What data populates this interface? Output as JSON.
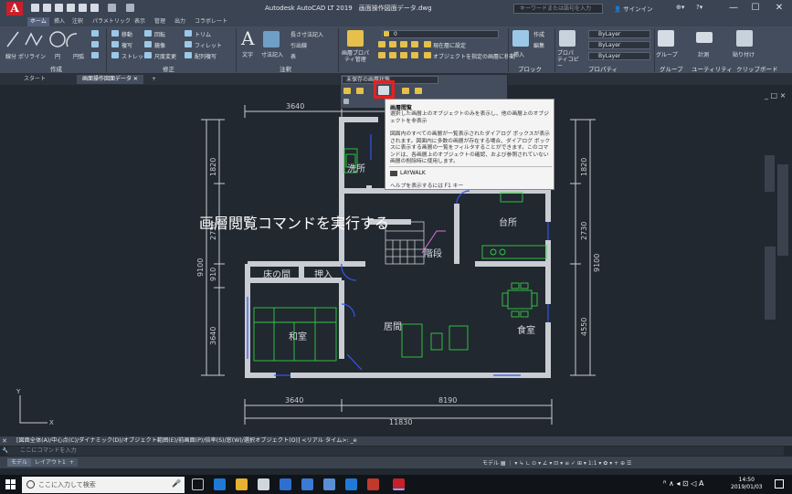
{
  "app": {
    "title": "Autodesk AutoCAD LT 2019　画面操作図面データ.dwg",
    "logo": "A",
    "search_placeholder": "キーワードまたは語句を入力",
    "signin": "サインイン",
    "colors": {
      "accent_red": "#e62020",
      "logo": "#c8202a",
      "canvas": "#212830",
      "plan_lines": "#c9ccd2"
    }
  },
  "ribbon_tabs": [
    "ホーム",
    "挿入",
    "注釈",
    "パラメトリック",
    "表示",
    "管理",
    "出力",
    "コラボレート"
  ],
  "ribbon": {
    "draw_tools": [
      "線分",
      "ポリライン",
      "円",
      "円弧"
    ],
    "modify_tools": [
      "移動",
      "回転",
      "トリム",
      "複写",
      "鏡像",
      "フィレット",
      "ストレッチ",
      "尺度変更",
      "配列複写"
    ],
    "annot_tools": [
      "文字",
      "寸法記入",
      "長さ寸法記入",
      "引出線",
      "表"
    ],
    "layer_tools": [
      "画層プロパティ管理",
      "現在層に設定",
      "オブジェクトを指定の画層に移動"
    ],
    "layer_current": "0",
    "block_tools": [
      "挿入",
      "作成",
      "編集"
    ],
    "properties": {
      "label": "プロパティコピー",
      "combo1": "ByLayer",
      "combo2": "ByLayer",
      "combo3": "ByLayer"
    },
    "groups_label": "グループ",
    "utility_label": "ユーティリティ",
    "measure_label": "計測",
    "paste_label": "貼り付け",
    "clipboard_label": "クリップボード",
    "group_titles": [
      "作成",
      "修正",
      "注釈",
      "ブロック",
      "プロパティ",
      "グループ",
      "ユーティリティ",
      "クリップボード"
    ]
  },
  "doc_tabs": {
    "start": "スタート",
    "drawing": "画面操作図面データ",
    "add": "+"
  },
  "layer_panel": {
    "state": "未保存の画層状態"
  },
  "tooltip": {
    "title": "画層閲覧",
    "body1": "選択した画層上のオブジェクトのみを表示し、他の画層上のオブジェクトを非表示",
    "body2": "図面内のすべての画層が一覧表示されたダイアログ ボックスが表示されます。図面内に多数の画層が存在する場合、ダイアログ ボックスに表示する画層の一覧をフィルタすることができます。このコマンドは、各画層上のオブジェクトの確認、および参照されていない画層の削除時に使用します。",
    "command": "LAYWALK",
    "help": "ヘルプを表示するには F1 キー"
  },
  "overlay_text": "画層閲覧コマンドを実行する",
  "plan": {
    "dims_top": [
      "3640",
      "8190"
    ],
    "dims_bottom": [
      "3640",
      "8190"
    ],
    "dim_total": "11830",
    "dims_left": [
      "1820",
      "2730",
      "910",
      "3640"
    ],
    "dim_left_total": "9100",
    "dims_right": [
      "1820",
      "2730",
      "4550"
    ],
    "dim_right_total": "9100",
    "rooms": [
      "洗所",
      "台所",
      "階段",
      "床の間",
      "押入",
      "和室",
      "居間",
      "食室"
    ]
  },
  "viewport_controls": "_ □ ×",
  "command": {
    "history": "[図面全体(A)/中心点(C)/ダイナミック(D)/オブジェクト範囲(E)/前画面(P)/倍率(S)/窓(W)/選択オブジェクト(O)] <リアル タイム>: _e",
    "input_placeholder": "ここにコマンドを入力"
  },
  "status_tabs": [
    "モデル",
    "レイアウト1",
    "+"
  ],
  "status_icons": "モデル ▦ ⋮ ▾ ↳ ∟ ⊙ ▾ ∠ ▾ ⊡ ▾ ≡ ✓ ⊞ ▾ 1:1 ▾ ✿ ▾ + ⊕ ☰",
  "taskbar": {
    "search": "ここに入力して検索",
    "time": "14:50",
    "date": "2019/01/03"
  }
}
